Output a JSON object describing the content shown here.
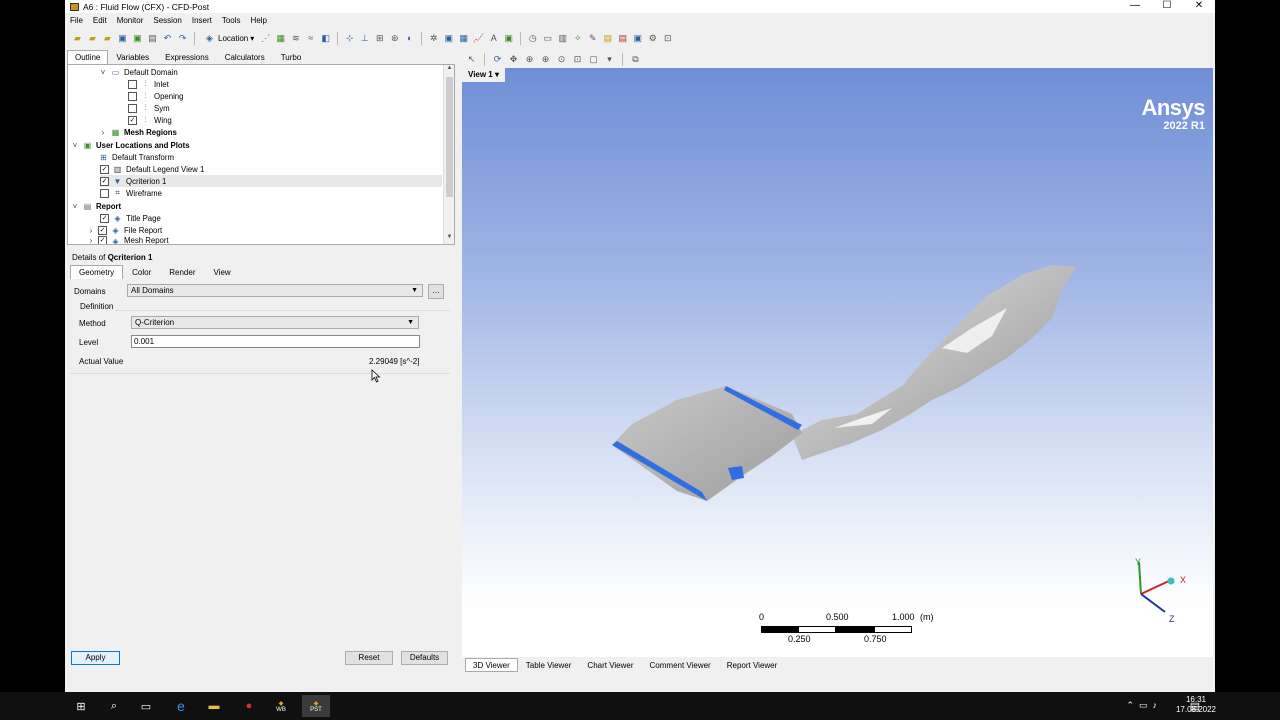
{
  "window": {
    "title": "A6 : Fluid Flow (CFX) - CFD-Post"
  },
  "menu": [
    "File",
    "Edit",
    "Monitor",
    "Session",
    "Insert",
    "Tools",
    "Help"
  ],
  "toolbar": {
    "location_label": "Location"
  },
  "outline_tabs": [
    "Outline",
    "Variables",
    "Expressions",
    "Calculators",
    "Turbo"
  ],
  "tree": {
    "default_domain": "Default Domain",
    "inlet": "Inlet",
    "opening": "Opening",
    "sym": "Sym",
    "wing": "Wing",
    "mesh_regions": "Mesh Regions",
    "user_locations": "User Locations and Plots",
    "default_transform": "Default Transform",
    "default_legend": "Default Legend View 1",
    "qcriterion": "Qcriterion 1",
    "wireframe": "Wireframe",
    "report": "Report",
    "title_page": "Title Page",
    "file_report": "File Report",
    "mesh_report": "Mesh Report"
  },
  "details": {
    "title_prefix": "Details of ",
    "title_obj": "Qcriterion 1",
    "tabs": [
      "Geometry",
      "Color",
      "Render",
      "View"
    ],
    "domains_label": "Domains",
    "domains_value": "All Domains",
    "ellipsis": "...",
    "definition_label": "Definition",
    "method_label": "Method",
    "method_value": "Q-Criterion",
    "level_label": "Level",
    "level_value": "0.001",
    "actual_label": "Actual Value",
    "actual_value": "2.29049 [s^-2]"
  },
  "buttons": {
    "apply": "Apply",
    "reset": "Reset",
    "defaults": "Defaults"
  },
  "viewer": {
    "view_label": "View 1",
    "brand_name": "Ansys",
    "brand_version": "2022 R1",
    "scale": {
      "t0": "0",
      "t1": "0.500",
      "t2": "1.000",
      "unit": "(m)",
      "b1": "0.250",
      "b2": "0.750"
    },
    "axes": {
      "x": "X",
      "y": "Y",
      "z": "Z"
    },
    "tabs": [
      "3D Viewer",
      "Table Viewer",
      "Chart Viewer",
      "Comment Viewer",
      "Report Viewer"
    ]
  },
  "taskbar": {
    "time": "16:31",
    "date": "17.08.2022",
    "wb_label": "WB",
    "pst_label": "PST"
  },
  "colors": {
    "wing_blue": "#2f6fe0",
    "surface_gray": "#c8c8c8",
    "bg_top": "#6f8ed6"
  }
}
